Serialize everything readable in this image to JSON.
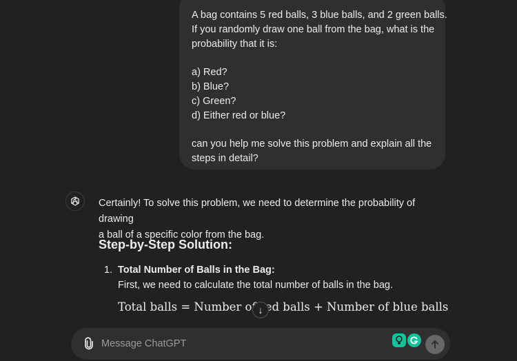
{
  "user_message": {
    "lines": [
      "A bag contains 5 red balls, 3 blue balls, and 2 green balls.",
      "If you randomly draw one ball from the bag, what is the",
      "probability that it is:",
      "",
      "a) Red?",
      "b) Blue?",
      "c) Green?",
      "d) Either red or blue?",
      "",
      "can you help me solve this problem and explain all the",
      "steps in detail?"
    ]
  },
  "assistant": {
    "intro_line1": "Certainly! To solve this problem, we need to determine the probability of drawing",
    "intro_line2": "a ball of a specific color from the bag.",
    "heading": "Step-by-Step Solution:",
    "step1_number": "1.",
    "step1_title": "Total Number of Balls in the Bag:",
    "step1_desc": "First, we need to calculate the total number of balls in the bag.",
    "formula": "Total balls = Number of red balls + Number of blue balls + Number of green balls"
  },
  "scroll_down": {
    "icon": "arrow-down-icon",
    "glyph": "↓"
  },
  "composer": {
    "placeholder": "Message ChatGPT"
  },
  "colors": {
    "background": "#212121",
    "bubble": "#2f2f2f",
    "grammarly": "#15c39a",
    "send_button": "#676767"
  }
}
